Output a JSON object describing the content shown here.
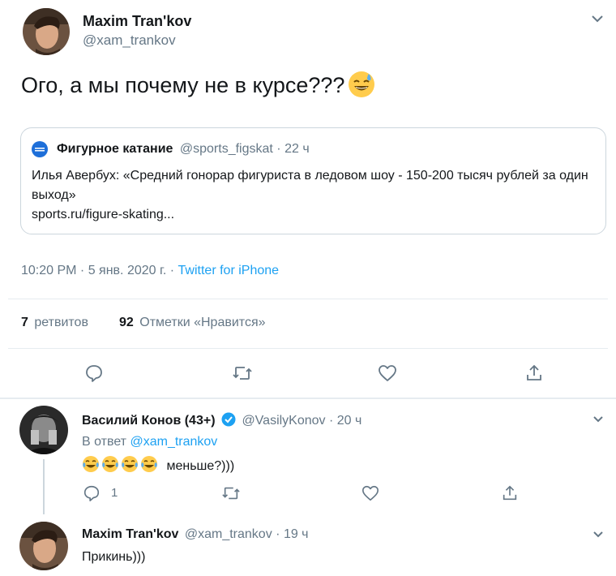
{
  "main_tweet": {
    "author_name": "Maxim Tran'kov",
    "author_handle": "@xam_trankov",
    "text": "Ого, а мы почему не в курсе???",
    "quote": {
      "author_name": "Фигурное катание",
      "author_handle": "@sports_figskat",
      "separator": "·",
      "time": "22 ч",
      "text": "Илья Авербух: «Средний гонорар фигуриста в ледовом шоу - 150-200 тысяч рублей за один выход»",
      "link": "sports.ru/figure-skating..."
    },
    "timestamp": "10:20 PM · 5 янв. 2020 г. · ",
    "source": "Twitter for iPhone",
    "retweets_count": "7",
    "retweets_label": "ретвитов",
    "likes_count": "92",
    "likes_label": "Отметки «Нравится»"
  },
  "reply_1": {
    "author_name": "Василий Конов (43+)",
    "author_handle": "@VasilyKonov",
    "separator": "·",
    "time": "20 ч",
    "reply_prefix": "В ответ",
    "reply_to": "@xam_trankov",
    "text": "меньше?)))",
    "reply_count": "1"
  },
  "reply_2": {
    "author_name": "Maxim Tran'kov",
    "author_handle": "@xam_trankov",
    "separator": "·",
    "time": "19 ч",
    "text": "Прикинь)))"
  },
  "icons": {
    "reply": "reply-icon",
    "retweet": "retweet-icon",
    "like": "heart-icon",
    "share": "share-icon",
    "more": "chevron-down-icon",
    "verified": "verified-badge-icon"
  },
  "colors": {
    "link": "#1da1f2",
    "secondary": "#657786",
    "text": "#14171a",
    "border": "#e6ecf0"
  }
}
